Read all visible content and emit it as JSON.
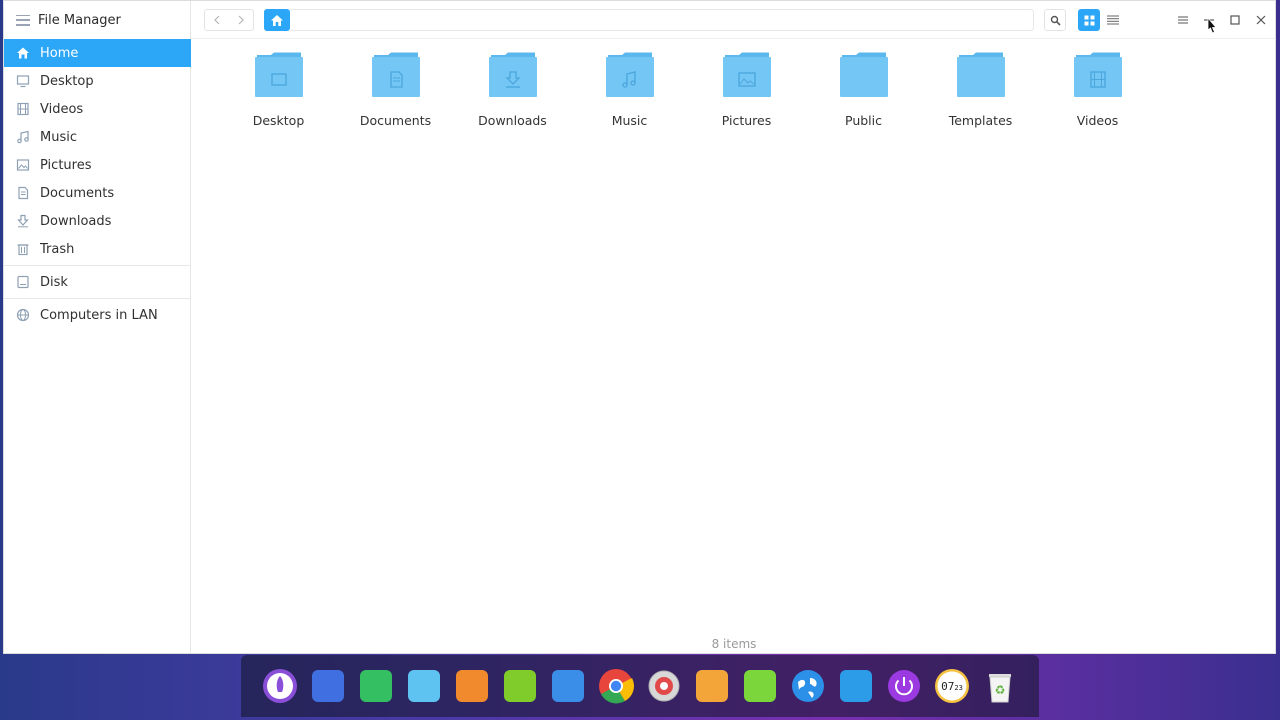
{
  "app": {
    "title": "File Manager"
  },
  "sidebar": {
    "items": [
      {
        "label": "Home",
        "icon": "home-icon",
        "active": true
      },
      {
        "label": "Desktop",
        "icon": "desktop-icon"
      },
      {
        "label": "Videos",
        "icon": "videos-icon"
      },
      {
        "label": "Music",
        "icon": "music-icon"
      },
      {
        "label": "Pictures",
        "icon": "pictures-icon"
      },
      {
        "label": "Documents",
        "icon": "documents-icon"
      },
      {
        "label": "Downloads",
        "icon": "downloads-icon"
      },
      {
        "label": "Trash",
        "icon": "trash-icon"
      }
    ],
    "disk": {
      "label": "Disk",
      "icon": "disk-icon"
    },
    "network": {
      "label": "Computers in LAN",
      "icon": "network-icon"
    }
  },
  "toolbar": {
    "back_icon": "chevron-left-icon",
    "forward_icon": "chevron-right-icon",
    "crumb_icon": "home-icon",
    "address": "",
    "search_icon": "search-icon",
    "icon_view_icon": "grid-view-icon",
    "list_view_icon": "list-view-icon"
  },
  "window_controls": [
    "menu-icon",
    "minimize-icon",
    "maximize-icon",
    "close-icon"
  ],
  "folders": [
    {
      "label": "Desktop",
      "emblem": "desktop"
    },
    {
      "label": "Documents",
      "emblem": "document"
    },
    {
      "label": "Downloads",
      "emblem": "download"
    },
    {
      "label": "Music",
      "emblem": "music"
    },
    {
      "label": "Pictures",
      "emblem": "picture"
    },
    {
      "label": "Public",
      "emblem": "none"
    },
    {
      "label": "Templates",
      "emblem": "none"
    },
    {
      "label": "Videos",
      "emblem": "video"
    }
  ],
  "status": {
    "items_text": "8 items"
  },
  "dock": {
    "apps": [
      "launcher-icon",
      "screenshot-icon",
      "store-icon",
      "file-manager-icon",
      "shop-icon",
      "music-player-icon",
      "video-player-icon",
      "chrome-icon",
      "settings-icon",
      "browser-icon",
      "power-manager-icon",
      "earth-icon",
      "network-tool-icon",
      "shutdown-icon",
      "clock-icon",
      "trash-icon"
    ],
    "clock_text": "07",
    "clock_sub": "23"
  },
  "colors": {
    "accent": "#2ca7f8",
    "folder": "#74c6f5",
    "folder_tab": "#5bb8ee"
  }
}
